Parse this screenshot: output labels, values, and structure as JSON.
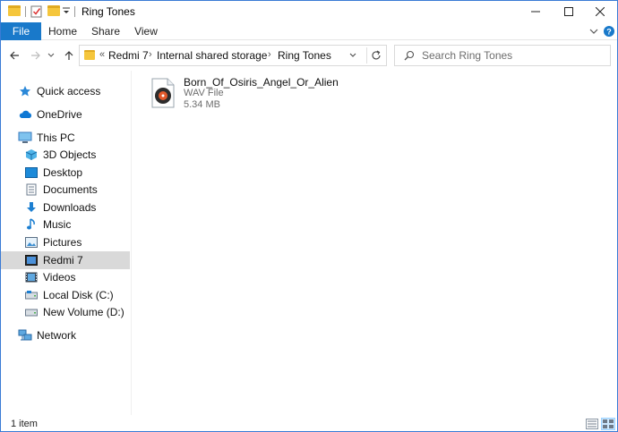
{
  "window": {
    "title": "Ring Tones",
    "minimize": "—",
    "maximize": "☐",
    "close": "✕"
  },
  "ribbon": {
    "tabs": [
      "File",
      "Home",
      "Share",
      "View"
    ]
  },
  "navigation": {
    "address_parts": [
      "Redmi 7",
      "Internal shared storage",
      "Ring Tones"
    ],
    "address_overflow": "«",
    "search_placeholder": "Search Ring Tones"
  },
  "sidebar": {
    "items": [
      {
        "label": "Quick access",
        "icon": "star-icon"
      },
      {
        "label": "OneDrive",
        "icon": "cloud-icon"
      },
      {
        "label": "This PC",
        "icon": "computer-icon"
      },
      {
        "label": "3D Objects",
        "icon": "cube-icon"
      },
      {
        "label": "Desktop",
        "icon": "desktop-icon"
      },
      {
        "label": "Documents",
        "icon": "document-icon"
      },
      {
        "label": "Downloads",
        "icon": "download-icon"
      },
      {
        "label": "Music",
        "icon": "music-icon"
      },
      {
        "label": "Pictures",
        "icon": "picture-icon"
      },
      {
        "label": "Redmi 7",
        "icon": "phone-icon",
        "selected": true
      },
      {
        "label": "Videos",
        "icon": "video-icon"
      },
      {
        "label": "Local Disk (C:)",
        "icon": "disk-icon"
      },
      {
        "label": "New Volume (D:)",
        "icon": "disk-icon"
      },
      {
        "label": "Network",
        "icon": "network-icon"
      }
    ]
  },
  "content": {
    "files": [
      {
        "name": "Born_Of_Osiris_Angel_Or_Alien",
        "type": "WAV File",
        "size": "5.34 MB",
        "icon": "audio-file-icon"
      }
    ]
  },
  "status": {
    "item_count": "1 item"
  },
  "colors": {
    "accent": "#1979ca",
    "selected": "#d9d9d9",
    "folder": "#f5c63c"
  }
}
